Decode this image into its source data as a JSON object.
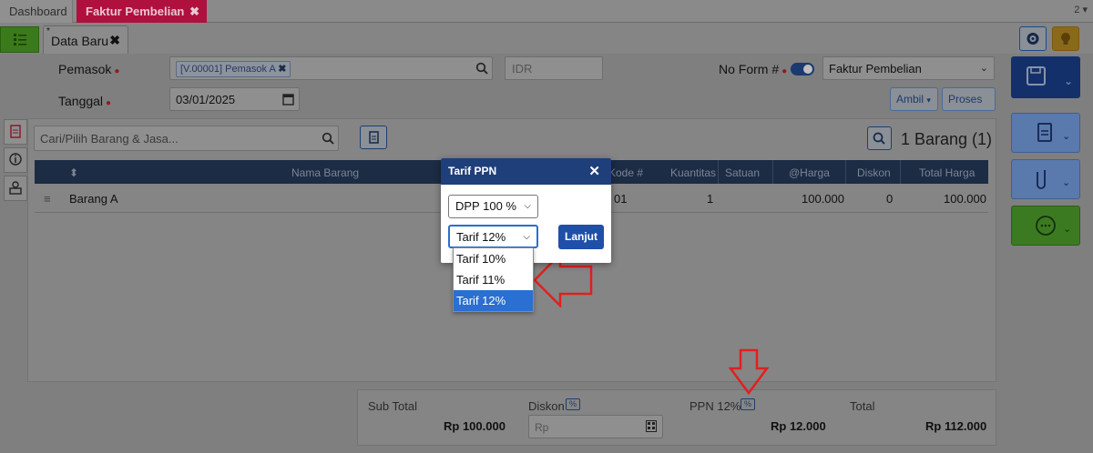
{
  "top_tabs": [
    {
      "label": "Dashboard"
    },
    {
      "label": "Faktur Pembelian"
    }
  ],
  "top_tab_counter": "2",
  "doc_tab": {
    "label": "Data Baru"
  },
  "form": {
    "pemasok_label": "Pemasok",
    "pemasok_value": "[V.00001] Pemasok A",
    "currency": "IDR",
    "no_form_label": "No Form #",
    "form_type": "Faktur Pembelian",
    "tanggal_label": "Tanggal",
    "tanggal_value": "03/01/2025",
    "ambil_label": "Ambil",
    "proses_label": "Proses"
  },
  "grid": {
    "search_placeholder": "Cari/Pilih Barang & Jasa...",
    "count_label": "1 Barang (1)",
    "columns": [
      "Nama Barang",
      "Kode #",
      "Kuantitas",
      "Satuan",
      "@Harga",
      "Diskon",
      "Total Harga"
    ],
    "rows": [
      {
        "nama": "Barang A",
        "kode": "01",
        "kuantitas": "1",
        "satuan": "",
        "harga": "100.000",
        "diskon": "0",
        "total": "100.000"
      }
    ]
  },
  "summary": {
    "subtotal_label": "Sub Total",
    "subtotal_value": "Rp 100.000",
    "diskon_label": "Diskon",
    "diskon_placeholder": "Rp",
    "ppn_label": "PPN 12%",
    "ppn_value": "Rp 12.000",
    "total_label": "Total",
    "total_value": "Rp 112.000",
    "pct_symbol": "%"
  },
  "modal": {
    "title": "Tarif PPN",
    "dpp_value": "DPP 100 %",
    "tarif_value": "Tarif 12%",
    "lanjut_label": "Lanjut",
    "tarif_options": [
      "Tarif 10%",
      "Tarif 11%",
      "Tarif 12%"
    ]
  },
  "colors": {
    "accent": "#1f3f7a",
    "tab_active": "#b0103e",
    "annotation": "#e0201e"
  }
}
